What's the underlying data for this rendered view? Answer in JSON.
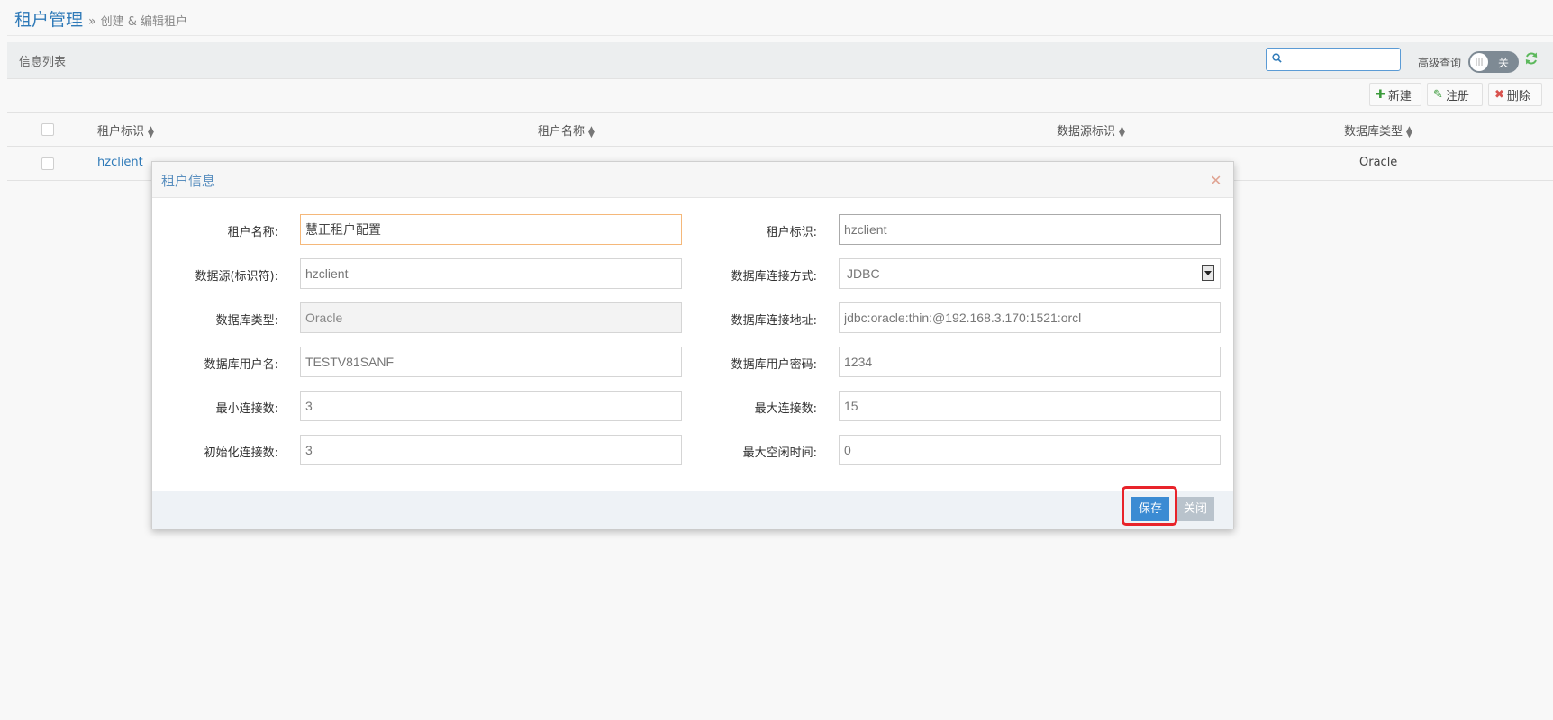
{
  "header": {
    "title": "租户管理",
    "breadcrumb_sep": "»",
    "breadcrumb": "创建 & 编辑租户"
  },
  "panel": {
    "title": "信息列表",
    "search_value": "",
    "advanced_label": "高级查询",
    "toggle_state": "关"
  },
  "toolbar": {
    "new_label": "新建",
    "register_label": "注册",
    "delete_label": "删除"
  },
  "table": {
    "columns": [
      "租户标识",
      "租户名称",
      "数据源标识",
      "数据库类型"
    ],
    "rows": [
      {
        "tenant_id": "hzclient",
        "db_type": "Oracle"
      }
    ]
  },
  "modal": {
    "title": "租户信息",
    "fields": {
      "tenant_name": {
        "label": "租户名称:",
        "value": "慧正租户配置"
      },
      "tenant_id": {
        "label": "租户标识:",
        "value": "hzclient"
      },
      "datasource": {
        "label": "数据源(标识符):",
        "value": "hzclient"
      },
      "conn_method": {
        "label": "数据库连接方式:",
        "value": "JDBC"
      },
      "db_type": {
        "label": "数据库类型:",
        "value": "Oracle"
      },
      "db_url": {
        "label": "数据库连接地址:",
        "value": "jdbc:oracle:thin:@192.168.3.170:1521:orcl"
      },
      "db_user": {
        "label": "数据库用户名:",
        "value": "TESTV81SANF"
      },
      "db_password": {
        "label": "数据库用户密码:",
        "value": "1234"
      },
      "min_conn": {
        "label": "最小连接数:",
        "value": "3"
      },
      "max_conn": {
        "label": "最大连接数:",
        "value": "15"
      },
      "init_conn": {
        "label": "初始化连接数:",
        "value": "3"
      },
      "max_idle": {
        "label": "最大空闲时间:",
        "value": "0"
      }
    },
    "save_label": "保存",
    "close_label": "关闭"
  },
  "colors": {
    "accent": "#2f7ab8",
    "save_button": "#3b8bd3",
    "highlight": "#e8232a"
  }
}
